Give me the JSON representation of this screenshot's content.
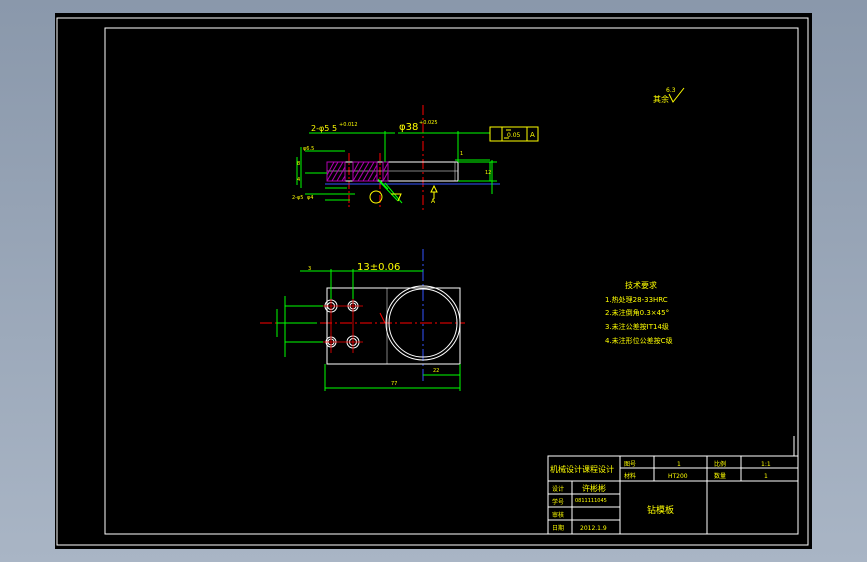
{
  "roughness": {
    "value": "6.3",
    "label": "其余"
  },
  "dimensions": {
    "holes": "2-φ5",
    "hole_depth": "5",
    "hole_tol": "+0.012",
    "bore": "φ38",
    "bore_tol": "+0.025",
    "small_a": "φ6.5",
    "small_b": "8",
    "small_c": "4",
    "small_d": "2-φ5",
    "small_e": "φ4",
    "thickness": "12",
    "chamfer": "1",
    "ref_letter": "A",
    "center_dist": "13±0.06",
    "left_offset": "3",
    "overall_len": "77",
    "partial_len": "22"
  },
  "fcf": {
    "flatness": "0.05",
    "datum": "A"
  },
  "tech": {
    "title": "技术要求",
    "items": [
      "1.热处理28-33HRC",
      "2.未注倒角0.3×45°",
      "3.未注公差按IT14级",
      "4.未注形位公差按C级"
    ]
  },
  "title_block": {
    "course": "机械设计课程设计",
    "drawing_no_label": "图号",
    "drawing_no": "1",
    "scale_label": "比例",
    "scale": "1:1",
    "material_label": "材料",
    "material": "HT200",
    "qty_label": "数量",
    "qty": "1",
    "designer_label": "设计",
    "designer": "许彬彬",
    "id_label": "学号",
    "id_no": "0811111045",
    "reviewer_label": "审核",
    "date_label": "日期",
    "date": "2012.1.9",
    "part_name": "钻模板"
  },
  "colors": {
    "frame": "#ffffff",
    "outline": "#ffffff",
    "dimension": "#00ff00",
    "text": "#ffff00",
    "centerline": "#ff0000",
    "hatch": "#b000b0",
    "axis": "#3355ff"
  }
}
